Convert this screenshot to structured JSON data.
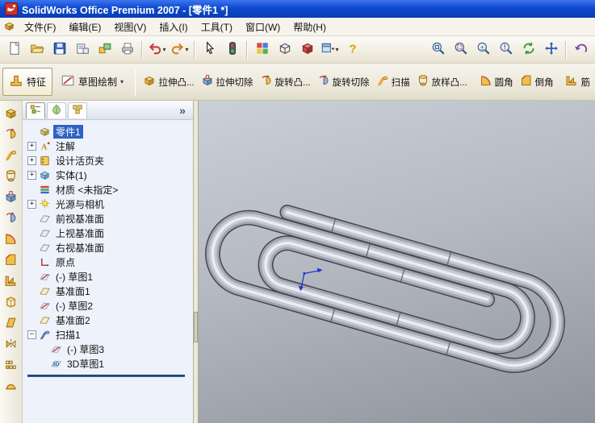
{
  "window": {
    "title": "SolidWorks Office Premium 2007 - [零件1 *]"
  },
  "menu_bar": {
    "items": [
      {
        "name": "file",
        "label": "文件(F)"
      },
      {
        "name": "edit",
        "label": "编辑(E)"
      },
      {
        "name": "view",
        "label": "视图(V)"
      },
      {
        "name": "insert",
        "label": "插入(I)"
      },
      {
        "name": "tools",
        "label": "工具(T)"
      },
      {
        "name": "window",
        "label": "窗口(W)"
      },
      {
        "name": "help",
        "label": "帮助(H)"
      }
    ]
  },
  "standard_toolbar": {
    "buttons": [
      {
        "name": "new-document",
        "icon": "new-document"
      },
      {
        "name": "open-folder",
        "icon": "open-folder"
      },
      {
        "name": "save",
        "icon": "save"
      },
      {
        "name": "make-drawing",
        "icon": "make-drawing"
      },
      {
        "name": "make-assembly",
        "icon": "make-assembly"
      },
      {
        "name": "print",
        "icon": "print"
      },
      {
        "separator": true
      },
      {
        "name": "undo",
        "icon": "undo",
        "dropdown": true
      },
      {
        "name": "redo",
        "icon": "redo",
        "dropdown": true
      },
      {
        "separator": true
      },
      {
        "name": "select",
        "icon": "select-cursor"
      },
      {
        "name": "rebuild",
        "icon": "rebuild"
      },
      {
        "separator": true
      },
      {
        "name": "edit-color",
        "icon": "edit-color"
      },
      {
        "name": "display-style",
        "icon": "display-style"
      },
      {
        "name": "standard-views",
        "icon": "standard-views-cube"
      },
      {
        "name": "view-orientation",
        "icon": "view-orientation",
        "dropdown": true
      },
      {
        "name": "help",
        "icon": "help"
      },
      {
        "gap": true
      },
      {
        "name": "zoom-to-fit",
        "icon": "zoom-fit"
      },
      {
        "name": "zoom-to-area",
        "icon": "zoom-area"
      },
      {
        "name": "zoom-in-out",
        "icon": "zoom-in-out"
      },
      {
        "name": "zoom-to-selection",
        "icon": "zoom-selected"
      },
      {
        "name": "rotate-view",
        "icon": "rotate-view"
      },
      {
        "name": "pan",
        "icon": "pan"
      },
      {
        "separator": true
      },
      {
        "name": "previous-view",
        "icon": "previous-view"
      }
    ]
  },
  "command_manager": {
    "tabs": [
      {
        "name": "tab-features",
        "label": "特征",
        "icon": "features-tab",
        "active": true
      },
      {
        "name": "tab-sketch",
        "label": "草图绘制",
        "icon": "sketch-tab",
        "dropdown": true
      }
    ],
    "buttons": [
      {
        "name": "extruded-boss-button",
        "label": "拉伸凸...",
        "icon": "extruded-boss"
      },
      {
        "name": "extruded-cut-button",
        "label": "拉伸切除",
        "icon": "extruded-cut"
      },
      {
        "name": "revolved-boss-button",
        "label": "旋转凸...",
        "icon": "revolved-boss"
      },
      {
        "name": "revolved-cut-button",
        "label": "旋转切除",
        "icon": "revolved-cut"
      },
      {
        "name": "swept-boss-button",
        "label": "扫描",
        "icon": "sweep"
      },
      {
        "name": "lofted-boss-button",
        "label": "放样凸...",
        "icon": "loft"
      },
      {
        "gap": true
      },
      {
        "name": "fillet-button",
        "label": "圆角",
        "icon": "fillet"
      },
      {
        "name": "chamfer-button",
        "label": "倒角",
        "icon": "chamfer"
      },
      {
        "gap": true
      },
      {
        "name": "rib-button",
        "label": "筋",
        "icon": "rib"
      }
    ]
  },
  "left_toolbar": {
    "buttons": [
      {
        "name": "extruded-boss",
        "icon": "extruded-boss"
      },
      {
        "name": "revolved-boss",
        "icon": "revolved-boss"
      },
      {
        "name": "swept-boss",
        "icon": "sweep"
      },
      {
        "name": "lofted-boss",
        "icon": "loft"
      },
      {
        "name": "extruded-cut",
        "icon": "extruded-cut"
      },
      {
        "name": "revolved-cut",
        "icon": "revolved-cut"
      },
      {
        "name": "fillet",
        "icon": "fillet"
      },
      {
        "name": "chamfer",
        "icon": "chamfer"
      },
      {
        "name": "rib",
        "icon": "rib"
      },
      {
        "name": "shell",
        "icon": "shell"
      },
      {
        "name": "draft",
        "icon": "draft"
      },
      {
        "name": "mirror",
        "icon": "mirror"
      },
      {
        "name": "linear-pattern",
        "icon": "linear-pattern"
      },
      {
        "name": "dome",
        "icon": "dome"
      }
    ]
  },
  "feature_panel": {
    "collapse_label": "»",
    "tabs": [
      {
        "name": "featuremanager-tab",
        "icon": "featuremanager-tab",
        "active": true
      },
      {
        "name": "propertymanager-tab",
        "icon": "propertymanager-tab"
      },
      {
        "name": "configmanager-tab",
        "icon": "configmanager-tab"
      }
    ],
    "tree": [
      {
        "name": "tree-item-part",
        "label": "零件1",
        "icon": "part",
        "selected": true,
        "indent": 0
      },
      {
        "name": "tree-item-annotations",
        "label": "注解",
        "icon": "annotations",
        "expand": "+",
        "indent": 0
      },
      {
        "name": "tree-item-design-binder",
        "label": "设计活页夹",
        "icon": "design-binder",
        "expand": "+",
        "indent": 0
      },
      {
        "name": "tree-item-solid-bodies",
        "label": "实体(1)",
        "icon": "solid-bodies",
        "expand": "+",
        "indent": 0
      },
      {
        "name": "tree-item-material",
        "label": "材质 <未指定>",
        "icon": "material",
        "indent": 0
      },
      {
        "name": "tree-item-lights-cameras",
        "label": "光源与相机",
        "icon": "lights-cameras",
        "expand": "+",
        "indent": 0
      },
      {
        "name": "tree-item-front-plane",
        "label": "前视基准面",
        "icon": "plane",
        "indent": 0
      },
      {
        "name": "tree-item-top-plane",
        "label": "上视基准面",
        "icon": "plane",
        "indent": 0
      },
      {
        "name": "tree-item-right-plane",
        "label": "右视基准面",
        "icon": "plane",
        "indent": 0
      },
      {
        "name": "tree-item-origin",
        "label": "原点",
        "icon": "origin",
        "indent": 0
      },
      {
        "name": "tree-item-sketch1",
        "label": "(-) 草图1",
        "icon": "sketch",
        "indent": 0
      },
      {
        "name": "tree-item-plane1",
        "label": "基准面1",
        "icon": "ref-plane",
        "indent": 0
      },
      {
        "name": "tree-item-sketch2",
        "label": "(-) 草图2",
        "icon": "sketch",
        "indent": 0
      },
      {
        "name": "tree-item-plane2",
        "label": "基准面2",
        "icon": "ref-plane",
        "indent": 0
      },
      {
        "name": "tree-item-sweep1",
        "label": "扫描1",
        "icon": "sweep-feature",
        "expand": "-",
        "indent": 0
      },
      {
        "name": "tree-item-sketch3",
        "label": "(-) 草图3",
        "icon": "sketch",
        "indent": 1
      },
      {
        "name": "tree-item-3dsketch1",
        "label": "3D草图1",
        "icon": "sketch-3d",
        "indent": 1
      }
    ]
  },
  "viewport": {
    "model": "paperclip",
    "selection_color": "#2f62c4"
  }
}
